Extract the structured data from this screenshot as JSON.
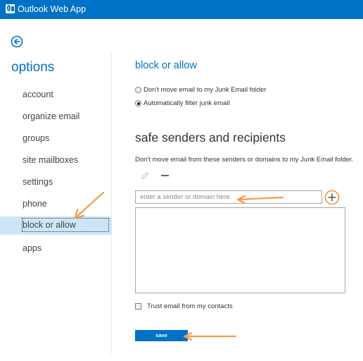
{
  "app": {
    "title": "Outlook Web App"
  },
  "colors": {
    "brand": "#0072c6",
    "selected_bg": "#cde6f7",
    "annotation": "#f39c4b"
  },
  "icons": {
    "logo": "outlook-logo-icon",
    "back": "back-arrow-icon",
    "edit": "pencil-icon",
    "remove": "minus-icon",
    "add": "plus-circle-icon"
  },
  "sidebar": {
    "title": "options",
    "items": [
      {
        "label": "account"
      },
      {
        "label": "organize email"
      },
      {
        "label": "groups"
      },
      {
        "label": "site mailboxes"
      },
      {
        "label": "settings"
      },
      {
        "label": "phone"
      },
      {
        "label": "block or allow",
        "selected": true
      },
      {
        "label": "apps"
      }
    ]
  },
  "main": {
    "section_title": "block or allow",
    "junk_options": [
      {
        "label": "Don't move email to my Junk Email folder",
        "checked": false
      },
      {
        "label": "Automatically filter junk email",
        "checked": true
      }
    ],
    "safe_senders": {
      "title": "safe senders and recipients",
      "description": "Don't move email from these senders or domains to my Junk Email folder.",
      "input_placeholder": "enter a sender or domain here",
      "input_value": "",
      "list": []
    },
    "trust_contacts": {
      "label": "Trust email from my contacts",
      "checked": false
    },
    "save_label": "save"
  }
}
